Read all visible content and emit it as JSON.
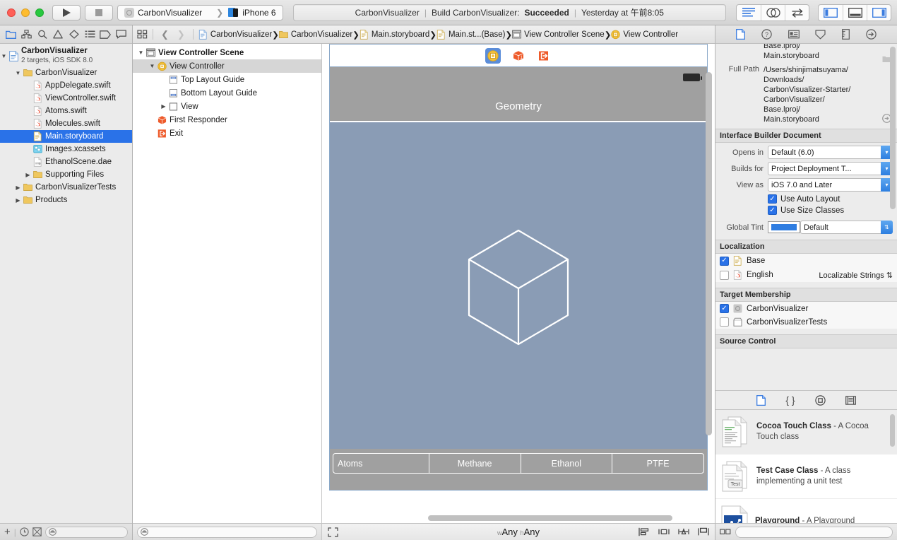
{
  "toolbar": {
    "run_label": "run-button",
    "stop_label": "stop-button",
    "scheme_name": "CarbonVisualizer",
    "destination_name": "iPhone 6",
    "status": {
      "project": "CarbonVisualizer",
      "separator": "|",
      "action": "Build CarbonVisualizer:",
      "result": "Succeeded",
      "time": "Yesterday at 午前8:05"
    },
    "editor_modes": [
      "standard-editor",
      "assistant-editor",
      "version-editor"
    ],
    "view_toggles": [
      "navigator-toggle",
      "debug-area-toggle",
      "utilities-toggle"
    ]
  },
  "navigator": {
    "tabs": [
      "project-navigator",
      "symbol-navigator",
      "find-navigator",
      "issue-navigator",
      "test-navigator",
      "debug-navigator",
      "breakpoint-navigator",
      "report-navigator"
    ],
    "project": {
      "name": "CarbonVisualizer",
      "subtitle": "2 targets, iOS SDK 8.0"
    },
    "items": [
      {
        "label": "CarbonVisualizer",
        "icon": "folder",
        "indent": 1,
        "twisty": "down",
        "selected": false
      },
      {
        "label": "AppDelegate.swift",
        "icon": "swift",
        "indent": 2,
        "twisty": "",
        "selected": false
      },
      {
        "label": "ViewController.swift",
        "icon": "swift",
        "indent": 2,
        "twisty": "",
        "selected": false
      },
      {
        "label": "Atoms.swift",
        "icon": "swift",
        "indent": 2,
        "twisty": "",
        "selected": false
      },
      {
        "label": "Molecules.swift",
        "icon": "swift",
        "indent": 2,
        "twisty": "",
        "selected": false
      },
      {
        "label": "Main.storyboard",
        "icon": "storyboard",
        "indent": 2,
        "twisty": "",
        "selected": true
      },
      {
        "label": "Images.xcassets",
        "icon": "xcassets",
        "indent": 2,
        "twisty": "",
        "selected": false
      },
      {
        "label": "EthanolScene.dae",
        "icon": "dae",
        "indent": 2,
        "twisty": "",
        "selected": false
      },
      {
        "label": "Supporting Files",
        "icon": "folder",
        "indent": 2,
        "twisty": "right",
        "selected": false
      },
      {
        "label": "CarbonVisualizerTests",
        "icon": "folder",
        "indent": 1,
        "twisty": "right",
        "selected": false
      },
      {
        "label": "Products",
        "icon": "folder",
        "indent": 1,
        "twisty": "right",
        "selected": false
      }
    ],
    "filter_placeholder": ""
  },
  "jumpbar": {
    "crumbs": [
      {
        "label": "CarbonVisualizer",
        "icon": "project"
      },
      {
        "label": "CarbonVisualizer",
        "icon": "folder"
      },
      {
        "label": "Main.storyboard",
        "icon": "storyboard"
      },
      {
        "label": "Main.st...(Base)",
        "icon": "storyboard"
      },
      {
        "label": "View Controller Scene",
        "icon": "scene"
      },
      {
        "label": "View Controller",
        "icon": "viewcontroller"
      }
    ]
  },
  "outline": {
    "items": [
      {
        "label": "View Controller Scene",
        "indent": 0,
        "twisty": "down",
        "icon": "scene",
        "bold": true,
        "selected": false
      },
      {
        "label": "View Controller",
        "indent": 1,
        "twisty": "down",
        "icon": "viewcontroller",
        "bold": false,
        "selected": true
      },
      {
        "label": "Top Layout Guide",
        "indent": 2,
        "twisty": "",
        "icon": "toplayout",
        "bold": false,
        "selected": false
      },
      {
        "label": "Bottom Layout Guide",
        "indent": 2,
        "twisty": "",
        "icon": "bottomlayout",
        "bold": false,
        "selected": false
      },
      {
        "label": "View",
        "indent": 2,
        "twisty": "right",
        "icon": "view",
        "bold": false,
        "selected": false
      },
      {
        "label": "First Responder",
        "indent": 1,
        "twisty": "",
        "icon": "firstresponder",
        "bold": false,
        "selected": false
      },
      {
        "label": "Exit",
        "indent": 1,
        "twisty": "",
        "icon": "exit",
        "bold": false,
        "selected": false
      }
    ]
  },
  "canvas": {
    "dock_icons": [
      "view-controller-icon",
      "first-responder-icon",
      "exit-icon"
    ],
    "navbar_title": "Geometry",
    "segments": [
      "Atoms",
      "Methane",
      "Ethanol",
      "PTFE"
    ],
    "size_class": {
      "width_prefix": "w",
      "width": "Any",
      "height_prefix": "h",
      "height": "Any"
    },
    "colors": {
      "body": "#8a9cb5",
      "bar": "#a0a0a0",
      "wireframe": "#ffffff"
    }
  },
  "inspector": {
    "tabs": [
      "file-inspector",
      "quick-help-inspector",
      "identity-inspector",
      "attributes-inspector",
      "size-inspector",
      "connections-inspector"
    ],
    "file_path_clipped": [
      "Base.lproj/",
      "Main.storyboard"
    ],
    "full_path_label": "Full Path",
    "full_path_lines": [
      "/Users/shinjimatsuyama/",
      "Downloads/",
      "CarbonVisualizer-Starter/",
      "CarbonVisualizer/",
      "Base.lproj/",
      "Main.storyboard"
    ],
    "ib_document": {
      "title": "Interface Builder Document",
      "fields": [
        {
          "label": "Opens in",
          "value": "Default (6.0)"
        },
        {
          "label": "Builds for",
          "value": "Project Deployment T..."
        },
        {
          "label": "View as",
          "value": "iOS 7.0 and Later"
        }
      ],
      "checkboxes": [
        {
          "label": "Use Auto Layout",
          "checked": true
        },
        {
          "label": "Use Size Classes",
          "checked": true
        }
      ],
      "global_tint": {
        "label": "Global Tint",
        "value": "Default",
        "color": "#2f7de1"
      }
    },
    "localization": {
      "title": "Localization",
      "rows": [
        {
          "label": "Base",
          "checked": true,
          "trailing": ""
        },
        {
          "label": "English",
          "checked": false,
          "trailing": "Localizable Strings"
        }
      ]
    },
    "target_membership": {
      "title": "Target Membership",
      "rows": [
        {
          "label": "CarbonVisualizer",
          "checked": true
        },
        {
          "label": "CarbonVisualizerTests",
          "checked": false
        }
      ]
    },
    "source_control": {
      "title": "Source Control"
    },
    "library_tabs": [
      "file-template-library",
      "code-snippet-library",
      "object-library",
      "media-library"
    ],
    "library_items": [
      {
        "title": "Cocoa Touch Class",
        "desc": "- A Cocoa Touch class",
        "selected": true,
        "icon": "cocoa-touch-class-icon"
      },
      {
        "title": "Test Case Class",
        "desc": "- A class implementing a unit test",
        "selected": false,
        "icon": "test-case-class-icon"
      },
      {
        "title": "Playground",
        "desc": "- A Playground",
        "selected": false,
        "icon": "playground-icon"
      }
    ]
  }
}
